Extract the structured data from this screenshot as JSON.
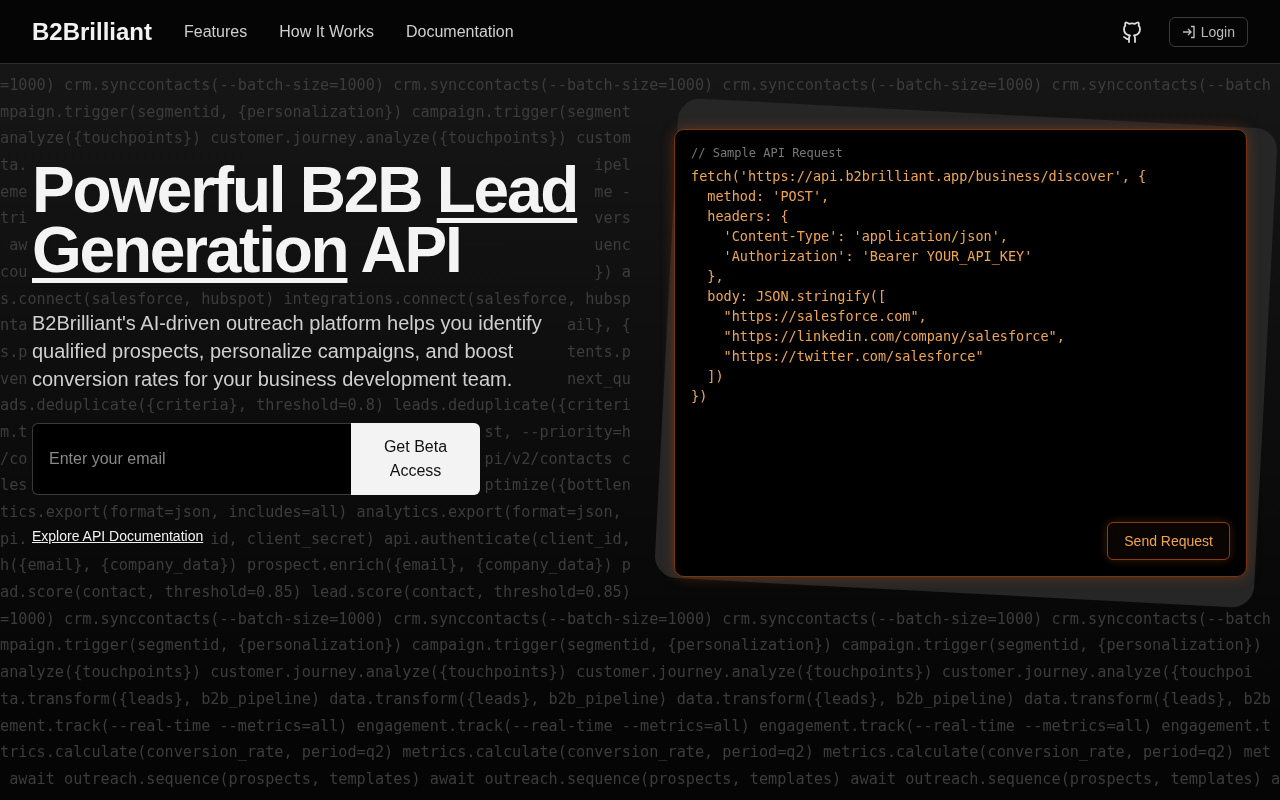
{
  "header": {
    "logo": "B2Brilliant",
    "nav": [
      "Features",
      "How It Works",
      "Documentation"
    ],
    "login": "Login"
  },
  "background_code": [
    {
      "fragments": [
        "=1000) crm.synccontacts(--batch-size=1000) crm.synccontacts(--batch-size=1000) crm.synccontacts(--batch-size=1000) crm.synccontacts(--batch"
      ]
    },
    {
      "fragments": [
        "mpaign.trigger(segmentid, {personalization}) campaign.trigger(segment"
      ]
    },
    {
      "fragments": [
        "analyze({touchpoints}) customer.journey.analyze({touchpoints}) custom"
      ]
    },
    {
      "fragments": [
        "ta.",
        "ipel"
      ]
    },
    {
      "fragments": [
        "eme",
        "me -"
      ]
    },
    {
      "fragments": [
        "tri",
        "vers"
      ]
    },
    {
      "fragments": [
        "aw",
        "uenc"
      ]
    },
    {
      "fragments": [
        "cou",
        "}) a"
      ]
    },
    {
      "fragments": [
        "s.connect(salesforce, hubspot) integrations.connect(salesforce, hubsp"
      ]
    },
    {
      "fragments": [
        "nta",
        "ail}, {"
      ]
    },
    {
      "fragments": [
        "s.p",
        "tents.p"
      ]
    },
    {
      "fragments": [
        "ven",
        "next_qu"
      ]
    },
    {
      "fragments": [
        "ads.deduplicate({criteria}, threshold=0.8) leads.deduplicate({criteri"
      ]
    },
    {
      "fragments": [
        "m.t",
        "st, --priority=h"
      ]
    },
    {
      "fragments": [
        "/co",
        "pi/v2/contacts c"
      ]
    },
    {
      "fragments": [
        "les",
        "ptimize({bottlen"
      ]
    },
    {
      "fragments": [
        "tics.export(format=json, includes=all) analytics.export(format=json,"
      ]
    },
    {
      "fragments": [
        "pi.",
        "id, client_secret) api.authenticate(client_id,"
      ]
    },
    {
      "fragments": [
        "h({email}, {company_data}) prospect.enrich({email}, {company_data}) p"
      ]
    },
    {
      "fragments": [
        "ad.score(contact, threshold=0.85) lead.score(contact, threshold=0.85)"
      ]
    },
    {
      "fragments": [
        "=1000) crm.synccontacts(--batch-size=1000) crm.synccontacts(--batch-size=1000) crm.synccontacts(--batch-size=1000) crm.synccontacts(--batch"
      ]
    },
    {
      "fragments": [
        "mpaign.trigger(segmentid, {personalization}) campaign.trigger(segmentid, {personalization}) campaign.trigger(segmentid, {personalization})"
      ]
    },
    {
      "fragments": [
        "analyze({touchpoints}) customer.journey.analyze({touchpoints}) customer.journey.analyze({touchpoints}) customer.journey.analyze({touchpoi"
      ]
    },
    {
      "fragments": [
        "ta.transform({leads}, b2b_pipeline) data.transform({leads}, b2b_pipeline) data.transform({leads}, b2b_pipeline) data.transform({leads}, b2b"
      ]
    },
    {
      "fragments": [
        "ement.track(--real-time --metrics=all) engagement.track(--real-time --metrics=all) engagement.track(--real-time --metrics=all) engagement.t"
      ]
    },
    {
      "fragments": [
        "trics.calculate(conversion_rate, period=q2) metrics.calculate(conversion_rate, period=q2) metrics.calculate(conversion_rate, period=q2) met"
      ]
    },
    {
      "fragments": [
        "await outreach.sequence(prospects, templates) await outreach.sequence(prospects, templates) await outreach.sequence(prospects, templates) a"
      ]
    }
  ],
  "hero": {
    "title": {
      "before": "Powerful B2B",
      "highlight": "Lead Generation",
      "after": "API"
    },
    "description": "B2Brilliant's AI-driven outreach platform helps you identify qualified prospects, personalize campaigns, and boost conversion rates for your business development team.",
    "email": {
      "placeholder": "Enter your email"
    },
    "cta": "Get Beta Access",
    "docs_link": "Explore API Documentation"
  },
  "api_card": {
    "comment": "// Sample API Request",
    "code": [
      "fetch('https://api.b2brilliant.app/business/discover', {",
      "  method: 'POST',",
      "  headers: {",
      "    'Content-Type': 'application/json',",
      "    'Authorization': 'Bearer YOUR_API_KEY'",
      "  },",
      "  body: JSON.stringify([",
      "    \"https://salesforce.com\",",
      "    \"https://linkedin.com/company/salesforce\",",
      "    \"https://twitter.com/salesforce\"",
      "  ])",
      "})"
    ],
    "button": "Send Request"
  }
}
